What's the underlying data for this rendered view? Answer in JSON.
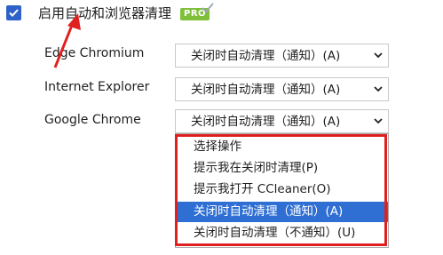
{
  "main": {
    "enable_label": "启用自动和浏览器清理",
    "pro_badge": "PRO",
    "enabled": true
  },
  "browsers": [
    {
      "label": "Edge Chromium",
      "selected": "关闭时自动清理（通知）(A)"
    },
    {
      "label": "Internet Explorer",
      "selected": "关闭时自动清理（通知）(A)"
    },
    {
      "label": "Google Chrome",
      "selected": "关闭时自动清理（通知）(A)"
    }
  ],
  "dropdown": {
    "options": [
      "选择操作",
      "提示我在关闭时清理(P)",
      "提示我打开 CCleaner(O)",
      "关闭时自动清理（通知）(A)",
      "关闭时自动清理（不通知）(U)"
    ],
    "highlighted": "关闭时自动清理（通知）(A)"
  },
  "colors": {
    "checkbox": "#2f62c8",
    "pro_badge": "#7fbf3a",
    "highlight": "#2f6fd4",
    "annotation": "#e02020"
  },
  "icons": [
    "checkmark-icon",
    "chevron-down-icon",
    "annotation-arrow-icon"
  ]
}
